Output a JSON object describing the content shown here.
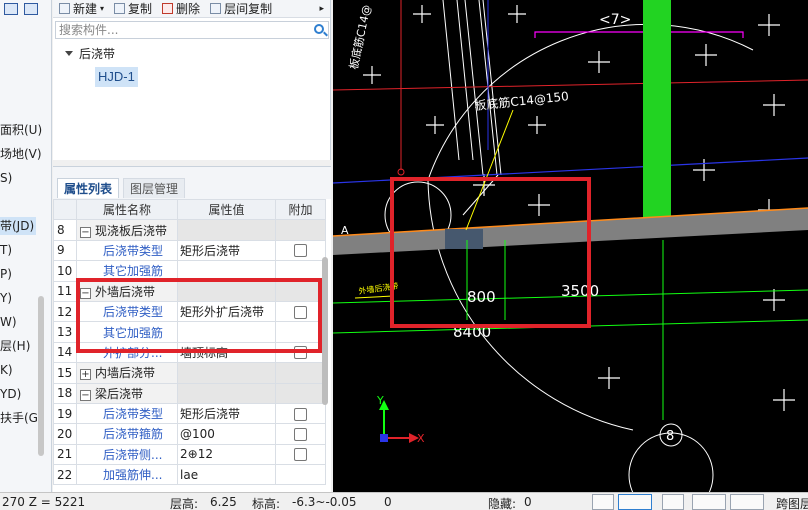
{
  "sidebar": {
    "items": [
      {
        "label": "面积(U)"
      },
      {
        "label": "场地(V)"
      },
      {
        "label": "S)"
      },
      {
        "label": "带(JD)",
        "active": true
      },
      {
        "label": "T)"
      },
      {
        "label": "P)"
      },
      {
        "label": "Y)"
      },
      {
        "label": "W)"
      },
      {
        "label": "层(H)"
      },
      {
        "label": "K)"
      },
      {
        "label": "YD)"
      },
      {
        "label": "扶手(G)"
      }
    ]
  },
  "tree_toolbar": {
    "new_label": "新建",
    "copy_label": "复制",
    "delete_label": "删除",
    "floor_copy_label": "层间复制",
    "more_label": "▸"
  },
  "tree": {
    "search_placeholder": "搜索构件...",
    "root_label": "后浇带",
    "child_label": "HJD-1"
  },
  "prop_panel": {
    "close_label": "×",
    "tab_active": "属性列表",
    "tab_inactive": "图层管理",
    "columns": [
      "属性名称",
      "属性值",
      "附加"
    ],
    "rows": [
      {
        "num": "8",
        "kind": "group",
        "expander": "−",
        "name": "现浇板后浇带",
        "value": "",
        "check": false
      },
      {
        "num": "9",
        "kind": "sub",
        "name": "后浇带类型",
        "value": "矩形后浇带",
        "check": true
      },
      {
        "num": "10",
        "kind": "sub",
        "name": "其它加强筋",
        "value": "",
        "check": false
      },
      {
        "num": "11",
        "kind": "group",
        "expander": "−",
        "name": "外墙后浇带",
        "value": "",
        "check": false
      },
      {
        "num": "12",
        "kind": "sub",
        "name": "后浇带类型",
        "value": "矩形外扩后浇带",
        "check": true
      },
      {
        "num": "13",
        "kind": "sub",
        "name": "其它加强筋",
        "value": "",
        "check": false
      },
      {
        "num": "14",
        "kind": "sub",
        "name": "外扩部分...",
        "value": "墙顶标高",
        "check": true
      },
      {
        "num": "15",
        "kind": "group",
        "expander": "+",
        "name": "内墙后浇带",
        "value": "",
        "check": false
      },
      {
        "num": "18",
        "kind": "group",
        "expander": "−",
        "name": "梁后浇带",
        "value": "",
        "check": false
      },
      {
        "num": "19",
        "kind": "sub",
        "name": "后浇带类型",
        "value": "矩形后浇带",
        "check": true
      },
      {
        "num": "20",
        "kind": "sub",
        "name": "后浇带箍筋",
        "value": "@100",
        "check": true
      },
      {
        "num": "21",
        "kind": "sub",
        "name": "后浇带侧...",
        "value": "2⊕12",
        "check": true
      },
      {
        "num": "22",
        "kind": "sub",
        "name": "加强筋伸...",
        "value": "lae",
        "check": false
      }
    ]
  },
  "cad": {
    "labels": {
      "rebar_1": "板底筋C14@",
      "rebar_2": "板底筋C14@150",
      "axis_7": "<7>",
      "dim_800": "800",
      "dim_3500": "3500",
      "dim_8400": "8400",
      "axis_8": "8",
      "hjd_text": "外墙后浇带",
      "a_label": "A",
      "axis_y": "Y",
      "axis_x": "X"
    },
    "colors": {
      "green_beam": "#22d322",
      "red_line": "#e0232a",
      "blue_line": "#2a35e8",
      "dim_green": "#12ff12",
      "wall_gray": "#808080",
      "magenta": "#ff00ff"
    }
  },
  "status_bar": {
    "coords": "270 Z = 5221",
    "floor_height_label": "层高:",
    "floor_height_value": "6.25",
    "elevation_label": "标高:",
    "elevation_value": "-6.3~-0.05",
    "misc_value": "0",
    "hidden_label": "隐藏:",
    "hidden_value": "0",
    "cross_floor_label": "跨图层"
  }
}
